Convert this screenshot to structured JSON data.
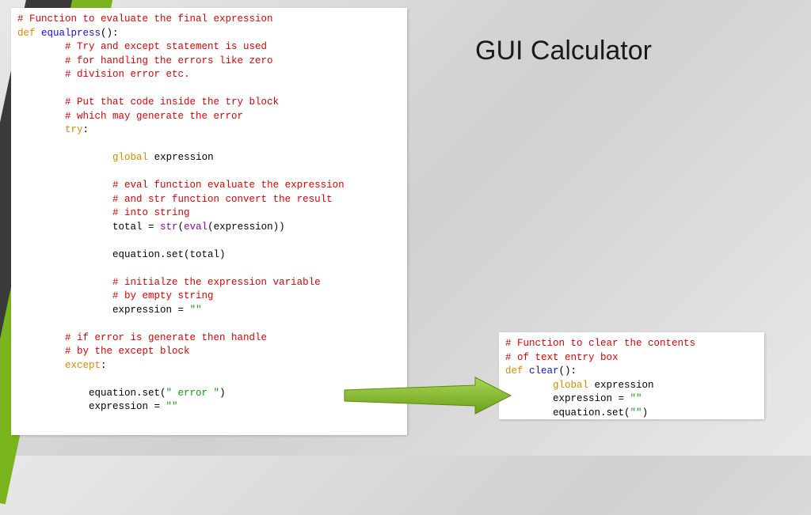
{
  "title": "GUI Calculator",
  "code_left": {
    "c1": "# Function to evaluate the final expression",
    "kw_def": "def",
    "fn": "equalpress",
    "c2": "# Try and except statement is used",
    "c3": "# for handling the errors like zero",
    "c4": "# division error etc.",
    "c5": "# Put that code inside the try block",
    "c6": "# which may generate the error",
    "kw_try": "try",
    "kw_global": "global",
    "var_expr": "expression",
    "c7": "# eval function evaluate the expression",
    "c8": "# and str function convert the result",
    "c9": "# into string",
    "bi_str": "str",
    "bi_eval": "eval",
    "stmt_total_a": "total = ",
    "stmt_total_b": "(expression))",
    "stmt_set_total": "equation.set(total)",
    "c10": "# initialze the expression variable",
    "c11": "# by empty string",
    "stmt_clear": "expression = ",
    "str_empty": "\"\"",
    "c12": "# if error is generate then handle",
    "c13": "# by the except block",
    "kw_except": "except",
    "stmt_err": "equation.set(",
    "str_err": "\" error \"",
    "stmt_clear2": "expression = "
  },
  "code_right": {
    "c1": "# Function to clear the contents",
    "c2": "# of text entry box",
    "kw_def": "def",
    "fn": "clear",
    "kw_global": "global",
    "var_expr": "expression",
    "stmt_clear": "expression = ",
    "str_empty": "\"\"",
    "stmt_set": "equation.set(",
    "paren_close": ")"
  }
}
